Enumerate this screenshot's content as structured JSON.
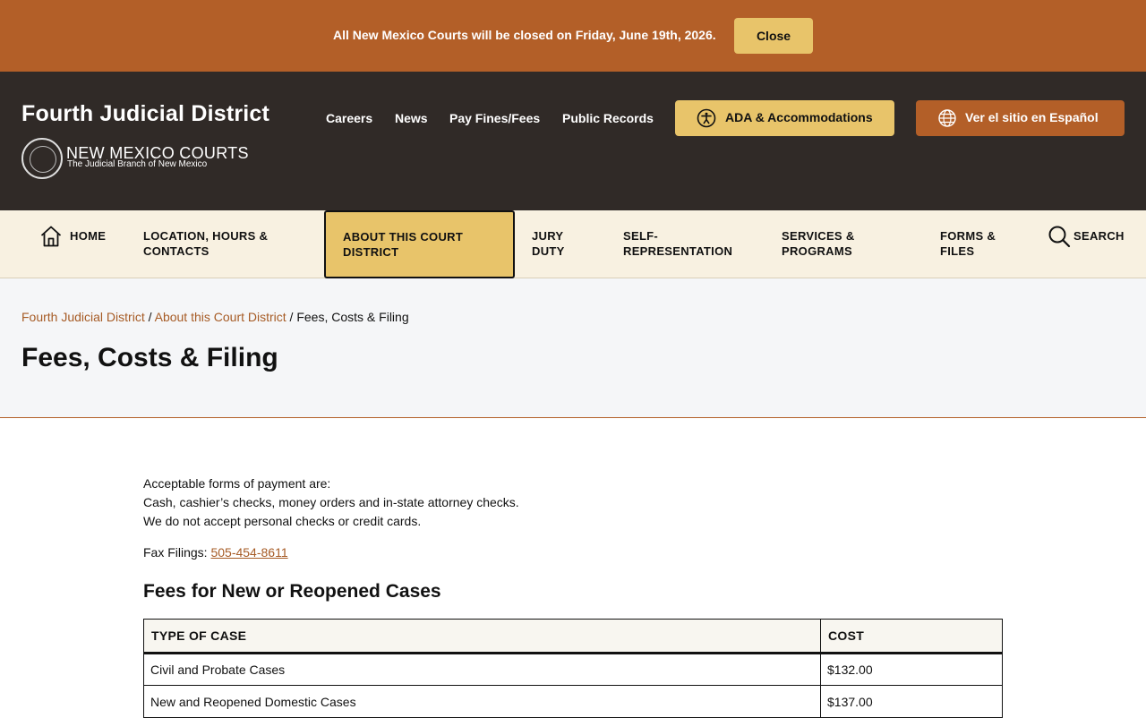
{
  "alert": {
    "message": "All New Mexico Courts will be closed on Friday, June 19th, 2026.",
    "close_label": "Close"
  },
  "header": {
    "site_title": "Fourth Judicial District",
    "org_name": "NEW MEXICO COURTS",
    "org_tagline": "The Judicial Branch of New Mexico",
    "utility_links": [
      "Careers",
      "News",
      "Pay Fines/Fees",
      "Public Records"
    ],
    "ada_label": "ADA & Accommodations",
    "spanish_label": "Ver el sitio en Español"
  },
  "nav": {
    "home": "HOME",
    "location_line1": "LOCATION, HOURS &",
    "location_line2": "CONTACTS",
    "about_line1": "ABOUT THIS COURT",
    "about_line2": "DISTRICT",
    "jury_line1": "JURY",
    "jury_line2": "DUTY",
    "self_line1": "SELF-",
    "self_line2": "REPRESENTATION",
    "services_line1": "SERVICES &",
    "services_line2": "PROGRAMS",
    "forms_line1": "FORMS &",
    "forms_line2": "FILES",
    "search": "SEARCH"
  },
  "breadcrumb": {
    "items": [
      "Fourth Judicial District",
      "About this Court District"
    ],
    "current": "Fees, Costs & Filing",
    "separator": " / "
  },
  "page": {
    "title": "Fees, Costs & Filing"
  },
  "content": {
    "payment_lines": [
      "Acceptable forms of payment are:",
      "Cash, cashier’s checks, money orders and in-state attorney checks.",
      "We do not accept personal checks or credit cards."
    ],
    "fax_label": "Fax Filings: ",
    "fax_number": "505-454-8611",
    "fees_heading": "Fees for New or Reopened Cases",
    "table": {
      "headers": [
        "TYPE OF CASE",
        "COST"
      ],
      "rows": [
        [
          "Civil and Probate Cases",
          "$132.00"
        ],
        [
          "New and Reopened Domestic Cases",
          "$137.00"
        ]
      ]
    }
  },
  "colors": {
    "brand_orange": "#b35f28",
    "accent_gold": "#e8c46a",
    "header_dark": "#302a27",
    "nav_bg": "#f8f1e1"
  }
}
